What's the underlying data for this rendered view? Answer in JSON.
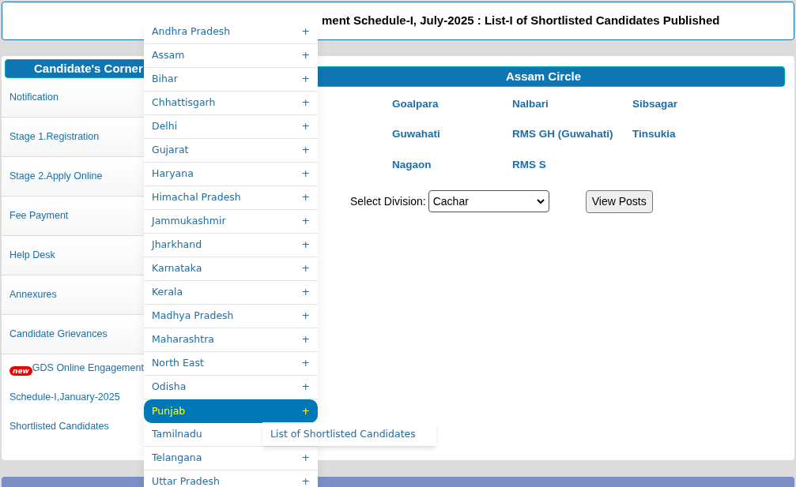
{
  "announcement": {
    "text": "ment Schedule-I, July-2025 : List-I of Shortlisted Candidates Published"
  },
  "sidebar": {
    "title": "Candidate's Corner",
    "items": [
      {
        "lines": [
          "Notification"
        ]
      },
      {
        "lines": [
          "Stage 1.Registration"
        ]
      },
      {
        "lines": [
          "Stage 2.Apply Online"
        ]
      },
      {
        "lines": [
          "Fee Payment"
        ]
      },
      {
        "lines": [
          "Help Desk"
        ]
      },
      {
        "lines": [
          "Annexures"
        ]
      },
      {
        "lines": [
          "Candidate Grievances"
        ]
      },
      {
        "badge": "new",
        "lines": [
          "GDS Online Engagement",
          "Schedule-I,January-2025",
          "Shortlisted Candidates"
        ]
      }
    ]
  },
  "circle": {
    "title": "Assam Circle",
    "divisions": [
      [
        "Goalpara",
        "Guwahati",
        "Nagaon"
      ],
      [
        "Nalbari",
        "RMS GH (Guwahati)",
        "RMS S"
      ],
      [
        "Sibsagar",
        "Tinsukia"
      ]
    ],
    "select_label": "Select Division:",
    "selected_division": "Cachar",
    "button": "View Posts"
  },
  "state_menu": {
    "items": [
      {
        "label": "Andhra Pradesh",
        "expander": "+",
        "selected": false
      },
      {
        "label": "Assam",
        "expander": "+",
        "selected": false
      },
      {
        "label": "Bihar",
        "expander": "+",
        "selected": false
      },
      {
        "label": "Chhattisgarh",
        "expander": "+",
        "selected": false
      },
      {
        "label": "Delhi",
        "expander": "+",
        "selected": false
      },
      {
        "label": "Gujarat",
        "expander": "+",
        "selected": false
      },
      {
        "label": "Haryana",
        "expander": "+",
        "selected": false
      },
      {
        "label": "Himachal Pradesh",
        "expander": "+",
        "selected": false
      },
      {
        "label": "Jammukashmir",
        "expander": "+",
        "selected": false
      },
      {
        "label": "Jharkhand",
        "expander": "+",
        "selected": false
      },
      {
        "label": "Karnataka",
        "expander": "+",
        "selected": false
      },
      {
        "label": "Kerala",
        "expander": "+",
        "selected": false
      },
      {
        "label": "Madhya Pradesh",
        "expander": "+",
        "selected": false
      },
      {
        "label": "Maharashtra",
        "expander": "+",
        "selected": false
      },
      {
        "label": "North East",
        "expander": "+",
        "selected": false
      },
      {
        "label": "Odisha",
        "expander": "+",
        "selected": false
      },
      {
        "label": "Punjab",
        "expander": "+",
        "selected": true,
        "submenu": [
          "List of Shortlisted Candidates"
        ]
      },
      {
        "label": "Tamilnadu",
        "selected": false
      },
      {
        "label": "Telangana",
        "expander": "+",
        "selected": false
      },
      {
        "label": "Uttar Pradesh",
        "expander": "+",
        "selected": false
      }
    ]
  }
}
